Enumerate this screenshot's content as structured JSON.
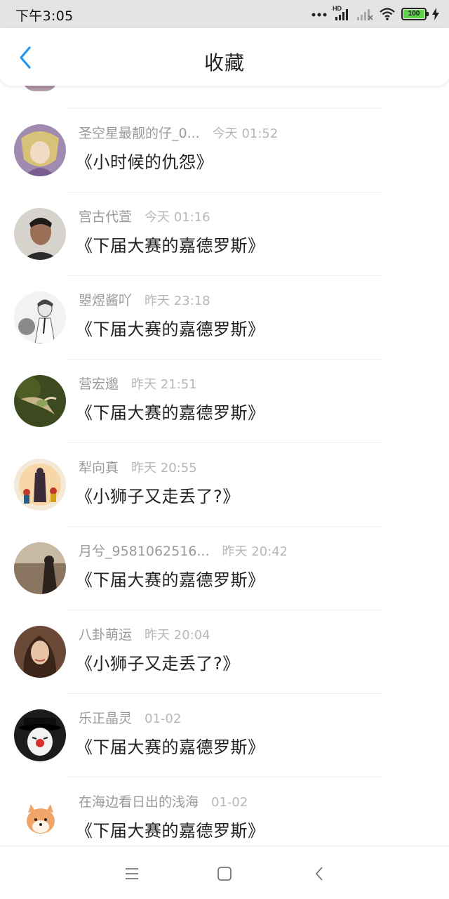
{
  "status_bar": {
    "time": "下午3:05",
    "network_label": "HD",
    "battery_level": "100"
  },
  "header": {
    "title": "收藏",
    "back_icon": "chevron-left-icon"
  },
  "items": [
    {
      "name": "圣空星最靓的仔_0...",
      "time": "今天 01:52",
      "content": "《小时候的仇怨》"
    },
    {
      "name": "宫古代萱",
      "time": "今天 01:16",
      "content": "《下届大赛的嘉德罗斯》"
    },
    {
      "name": "曌煜酱吖",
      "time": "昨天 23:18",
      "content": "《下届大赛的嘉德罗斯》"
    },
    {
      "name": "营宏邈",
      "time": "昨天 21:51",
      "content": "《下届大赛的嘉德罗斯》"
    },
    {
      "name": "犁向真",
      "time": "昨天 20:55",
      "content": "《小狮子又走丢了?》"
    },
    {
      "name": "月兮_9581062516...",
      "time": "昨天 20:42",
      "content": "《下届大赛的嘉德罗斯》"
    },
    {
      "name": "八卦萌运",
      "time": "昨天 20:04",
      "content": "《小狮子又走丢了?》"
    },
    {
      "name": "乐正晶灵",
      "time": "01-02",
      "content": "《下届大赛的嘉德罗斯》"
    },
    {
      "name": "在海边看日出的浅海",
      "time": "01-02",
      "content": "《下届大赛的嘉德罗斯》"
    }
  ],
  "nav_bar": {
    "menu_icon": "menu-icon",
    "home_icon": "home-square-icon",
    "back_icon": "back-triangle-icon"
  },
  "colors": {
    "accent": "#2196f3",
    "status_bar_bg": "#e4e4e4",
    "battery": "#5ed34a"
  }
}
